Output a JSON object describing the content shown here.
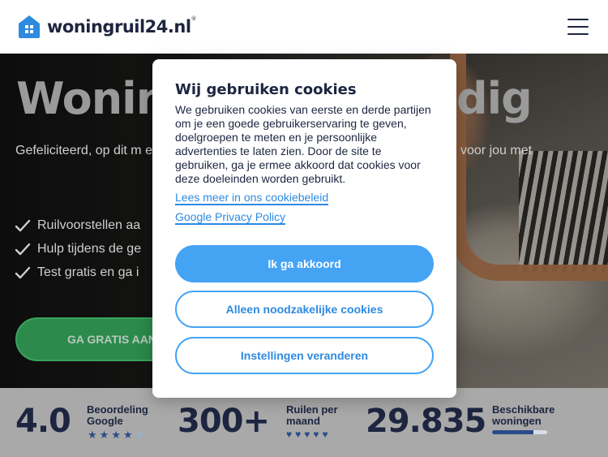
{
  "header": {
    "brand": "woningruil24.nl",
    "trademark": "®"
  },
  "hero": {
    "title_left": "Woning",
    "title_right": "dig",
    "subtitle_left": "Gefeliciteerd, op dit m een huurcontract.",
    "subtitle_right": "voor jou met",
    "checklist": [
      "Ruilvoorstellen aa",
      "Hulp tijdens de ge",
      "Test gratis en ga i"
    ],
    "cta_label": "GA GRATIS AAN"
  },
  "stats": {
    "rating": {
      "value": "4.0",
      "label": "Beoordeling Google",
      "stars": 4,
      "max_stars": 5
    },
    "swaps": {
      "value": "300+",
      "label": "Ruilen per maand",
      "hearts": 5
    },
    "available": {
      "value": "29.835",
      "label": "Beschikbare woningen",
      "bar_fraction": 0.75
    }
  },
  "cookie_modal": {
    "title": "Wij gebruiken cookies",
    "body": "We gebruiken cookies van eerste en derde partijen om je een goede gebruikerservaring te geven, doelgroepen te meten en je persoonlijke advertenties te laten zien. Door de site te gebruiken, ga je ermee akkoord dat cookies voor deze doeleinden worden gebruikt.",
    "link_cookie_policy": "Lees meer in ons cookiebeleid",
    "link_google_privacy": "Google Privacy Policy",
    "accept_label": "Ik ga akkoord",
    "necessary_only_label": "Alleen noodzakelijke cookies",
    "settings_label": "Instellingen veranderen"
  },
  "colors": {
    "brand_blue": "#2d8ae0",
    "button_blue": "#45a3f4",
    "navy": "#1d2540",
    "cta_green": "#2b8a4c",
    "accent_orange": "#d18a5b"
  }
}
